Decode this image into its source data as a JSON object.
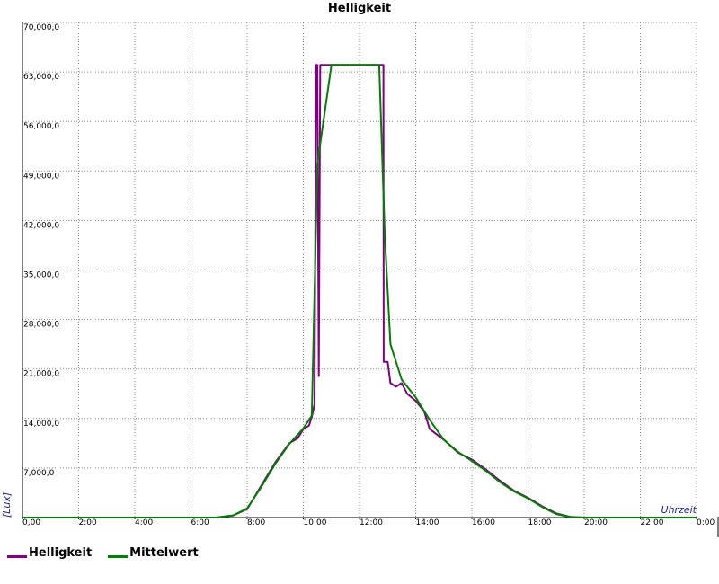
{
  "chart_data": {
    "type": "line",
    "title": "Helligkeit",
    "xlabel": "Uhrzeit",
    "ylabel": "[Lux]",
    "xlim": [
      0,
      24
    ],
    "ylim": [
      0,
      70000
    ],
    "x_ticks": [
      0,
      2,
      4,
      6,
      8,
      10,
      12,
      14,
      16,
      18,
      20,
      22,
      24
    ],
    "x_tick_labels": [
      "0,00",
      "2:00",
      "4:00",
      "6:00",
      "8:00",
      "10:00",
      "12:00",
      "14:00",
      "16:00",
      "18:00",
      "20:00",
      "22:00",
      "0:00"
    ],
    "y_ticks": [
      7000,
      14000,
      21000,
      28000,
      35000,
      42000,
      49000,
      56000,
      63000,
      70000
    ],
    "y_tick_labels": [
      "7,000,0",
      "14,000,0",
      "21,000,0",
      "28,000,0",
      "35,000,0",
      "42,000,0",
      "49,000,0",
      "56,000,0",
      "63,000,0",
      "70,000,0"
    ],
    "grid": true,
    "legend_position": "bottom-left",
    "series": [
      {
        "name": "Helligkeit",
        "color": "#800080",
        "points": [
          [
            0,
            0
          ],
          [
            6.9,
            0
          ],
          [
            7.5,
            300
          ],
          [
            8,
            1200
          ],
          [
            8.5,
            4500
          ],
          [
            9,
            7800
          ],
          [
            9.5,
            10500
          ],
          [
            9.8,
            11200
          ],
          [
            10,
            12500
          ],
          [
            10.2,
            13000
          ],
          [
            10.3,
            14200
          ],
          [
            10.4,
            16000
          ],
          [
            10.45,
            64000
          ],
          [
            10.5,
            64000
          ],
          [
            10.55,
            20000
          ],
          [
            10.6,
            64000
          ],
          [
            11.5,
            64000
          ],
          [
            12.5,
            64000
          ],
          [
            12.85,
            64000
          ],
          [
            12.86,
            22000
          ],
          [
            13,
            22000
          ],
          [
            13.1,
            19000
          ],
          [
            13.3,
            18500
          ],
          [
            13.5,
            19000
          ],
          [
            13.7,
            17500
          ],
          [
            14,
            16500
          ],
          [
            14.3,
            15000
          ],
          [
            14.5,
            12500
          ],
          [
            15,
            11000
          ],
          [
            15.5,
            9200
          ],
          [
            16,
            8200
          ],
          [
            16.5,
            6800
          ],
          [
            17,
            5200
          ],
          [
            17.5,
            3800
          ],
          [
            18,
            2800
          ],
          [
            18.5,
            1600
          ],
          [
            19,
            600
          ],
          [
            19.5,
            100
          ],
          [
            20,
            0
          ],
          [
            24,
            0
          ]
        ]
      },
      {
        "name": "Mittelwert",
        "color": "#008000",
        "points": [
          [
            0,
            0
          ],
          [
            6.9,
            0
          ],
          [
            7.5,
            300
          ],
          [
            8,
            1300
          ],
          [
            8.5,
            4300
          ],
          [
            9,
            7600
          ],
          [
            9.5,
            10400
          ],
          [
            10,
            12600
          ],
          [
            10.3,
            14400
          ],
          [
            10.5,
            50000
          ],
          [
            11,
            64000
          ],
          [
            12.5,
            64000
          ],
          [
            12.7,
            64000
          ],
          [
            12.9,
            40000
          ],
          [
            13.1,
            24500
          ],
          [
            13.5,
            19500
          ],
          [
            14,
            17000
          ],
          [
            14.5,
            13800
          ],
          [
            15,
            11000
          ],
          [
            15.5,
            9300
          ],
          [
            16,
            8000
          ],
          [
            16.5,
            6600
          ],
          [
            17,
            5000
          ],
          [
            17.5,
            3700
          ],
          [
            18,
            2700
          ],
          [
            18.5,
            1500
          ],
          [
            19,
            500
          ],
          [
            19.5,
            80
          ],
          [
            20,
            0
          ],
          [
            24,
            0
          ]
        ]
      }
    ]
  }
}
